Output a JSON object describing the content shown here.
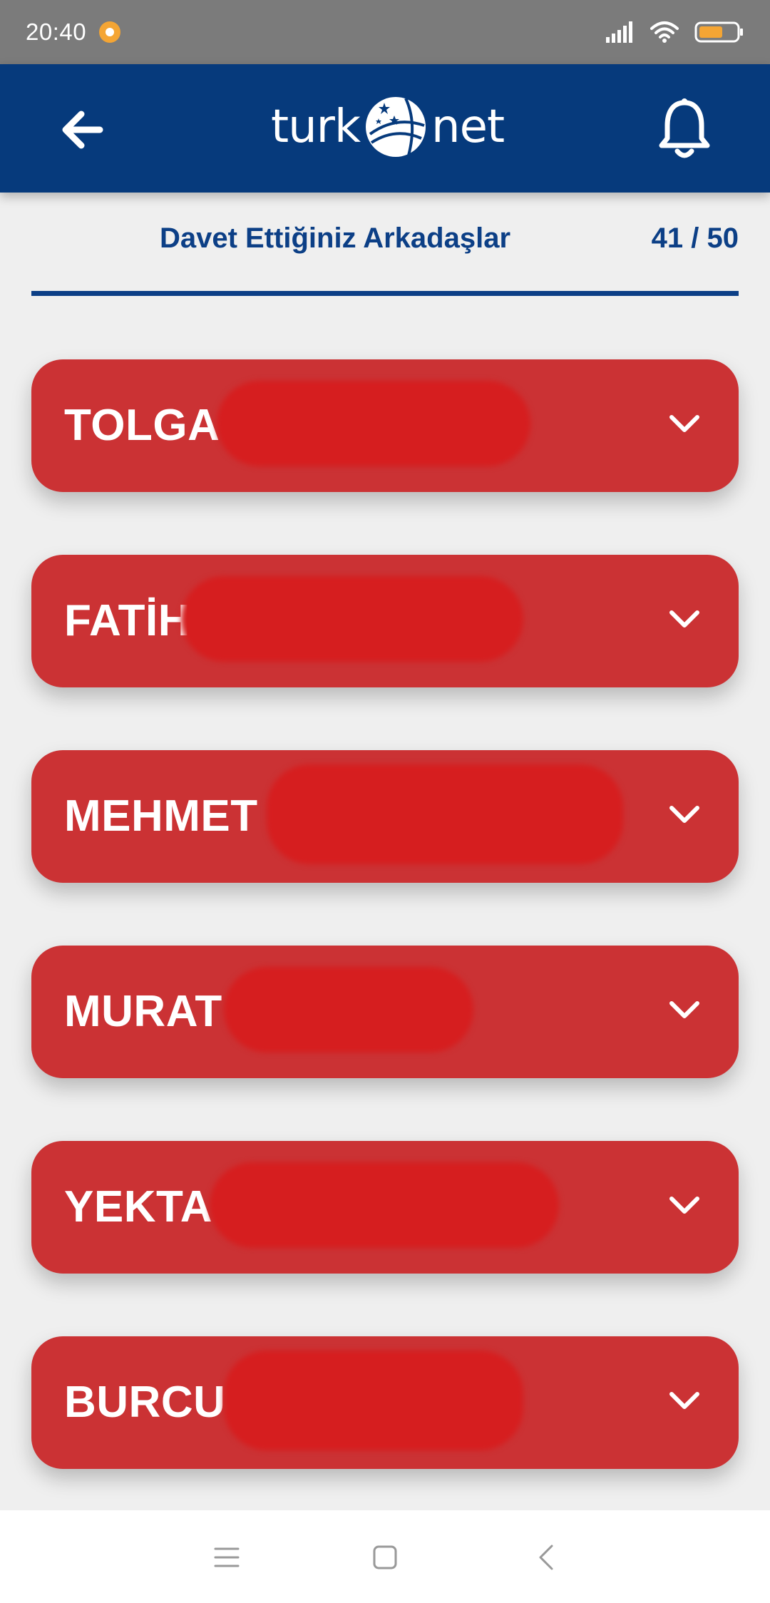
{
  "status_bar": {
    "time": "20:40",
    "notification_icon": "notification-dot-icon",
    "icons": [
      "signal-icon",
      "wifi-icon",
      "battery-icon"
    ],
    "battery_color": "#f4a534"
  },
  "header": {
    "logo_left": "turk",
    "logo_right": "net",
    "back_icon": "arrow-left-icon",
    "bell_icon": "bell-icon",
    "background": "#063a7c"
  },
  "section": {
    "title": "Davet Ettiğiniz Arkadaşlar",
    "count": "41 / 50",
    "accent": "#0c3f86"
  },
  "friends": [
    {
      "name": "TOLGA"
    },
    {
      "name": "FATİH"
    },
    {
      "name": "MEHMET"
    },
    {
      "name": "MURAT"
    },
    {
      "name": "YEKTA"
    },
    {
      "name": "BURCU"
    }
  ],
  "card_color": "#cb3234",
  "nav": {
    "icons": [
      "menu-icon",
      "home-square-icon",
      "back-chevron-icon"
    ]
  }
}
